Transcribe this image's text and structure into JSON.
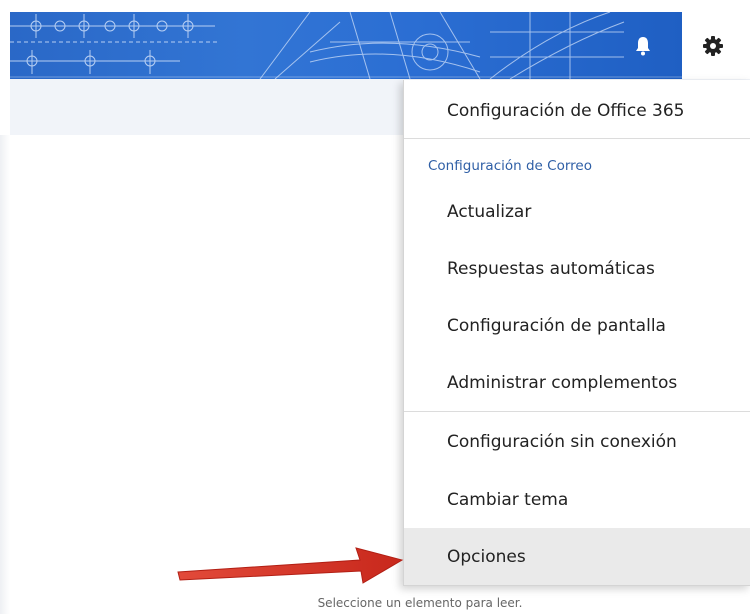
{
  "header": {
    "bell_icon": "bell-icon",
    "gear_icon": "gear-icon"
  },
  "settings_menu": {
    "top_item": "Configuración de Office 365",
    "section_label": "Configuración de Correo",
    "items": [
      "Actualizar",
      "Respuestas automáticas",
      "Configuración de pantalla",
      "Administrar complementos",
      "Configuración sin conexión",
      "Cambiar tema",
      "Opciones"
    ],
    "highlighted": "Opciones"
  },
  "reading_pane": {
    "empty_message": "Seleccione un elemento para leer."
  },
  "colors": {
    "banner": "#2b6ed3",
    "section_label": "#2f5fa6",
    "highlight": "#eaeaea",
    "annotation_arrow": "#d93a2b"
  }
}
